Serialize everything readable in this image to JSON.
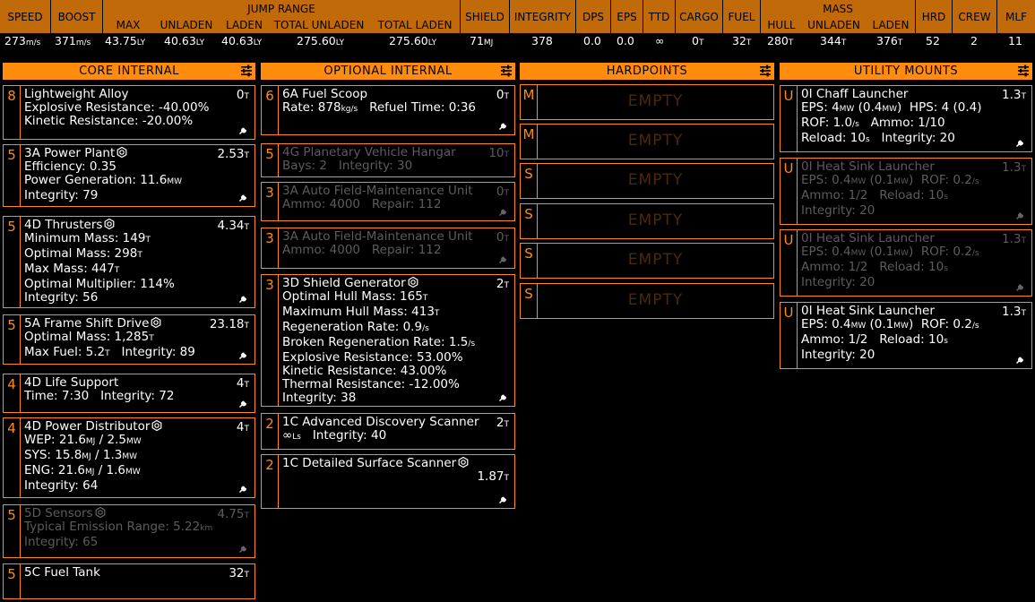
{
  "stats": {
    "headers": {
      "speed": "SPEED",
      "boost": "BOOST",
      "jump_range": "JUMP RANGE",
      "jr_max": "MAX",
      "jr_unladen": "UNLADEN",
      "jr_laden": "LADEN",
      "jr_total_unladen": "TOTAL UNLADEN",
      "jr_total_laden": "TOTAL LADEN",
      "shield": "SHIELD",
      "integrity": "INTEGRITY",
      "dps": "DPS",
      "eps": "EPS",
      "ttd": "TTD",
      "cargo": "CARGO",
      "fuel": "FUEL",
      "mass": "MASS",
      "mass_hull": "HULL",
      "mass_unladen": "UNLADEN",
      "mass_laden": "LADEN",
      "hrd": "HRD",
      "crew": "CREW",
      "mlf": "MLF"
    },
    "values": {
      "speed": "273",
      "speed_u": "m/s",
      "boost": "371",
      "boost_u": "m/s",
      "jr_max": "43.75",
      "jr_max_u": "LY",
      "jr_unladen": "40.63",
      "jr_unladen_u": "LY",
      "jr_laden": "40.63",
      "jr_laden_u": "LY",
      "jr_total_unladen": "275.60",
      "jr_total_unladen_u": "LY",
      "jr_total_laden": "275.60",
      "jr_total_laden_u": "LY",
      "shield": "71",
      "shield_u": "MJ",
      "integrity": "378",
      "dps": "0.0",
      "eps": "0.0",
      "ttd": "∞",
      "cargo": "0",
      "cargo_u": "T",
      "fuel": "32",
      "fuel_u": "T",
      "mass_hull": "280",
      "mass_hull_u": "T",
      "mass_unladen": "344",
      "mass_unladen_u": "T",
      "mass_laden": "376",
      "mass_laden_u": "T",
      "hrd": "52",
      "crew": "2",
      "mlf": "11"
    }
  },
  "columns": {
    "core": {
      "title": "CORE INTERNAL"
    },
    "optional": {
      "title": "OPTIONAL INTERNAL"
    },
    "hardpoints": {
      "title": "HARDPOINTS"
    },
    "utility": {
      "title": "UTILITY MOUNTS"
    }
  },
  "core": [
    {
      "cls": "8",
      "name": "Lightweight Alloy",
      "mass": "0",
      "mass_u": "T",
      "l1": "Explosive Resistance: -40.00%",
      "l2": "Kinetic Resistance: -20.00%"
    },
    {
      "cls": "5",
      "name": "3A Power Plant",
      "mass": "2.53",
      "mass_u": "T",
      "l1": "Efficiency: 0.35",
      "l2a": "Power Generation: 11.6",
      "l2u": "MW",
      "l3": "Integrity: 79"
    },
    {
      "cls": "5",
      "name": "4D Thrusters",
      "mass": "4.34",
      "mass_u": "T",
      "l1a": "Minimum Mass: 149",
      "l1u": "T",
      "l2a": "Optimal Mass: 298",
      "l2u": "T",
      "l3a": "Max Mass: 447",
      "l3u": "T",
      "l4": "Optimal Multiplier: 114%",
      "l5": "Integrity: 56"
    },
    {
      "cls": "5",
      "name": "5A Frame Shift Drive",
      "mass": "23.18",
      "mass_u": "T",
      "l1a": "Optimal Mass: 1,285",
      "l1u": "T",
      "l2a": "Max Fuel: 5.2",
      "l2u": "T",
      "l2b": "Integrity: 89"
    },
    {
      "cls": "4",
      "name": "4D Life Support",
      "mass": "4",
      "mass_u": "T",
      "l1": "Time: 7:30",
      "l1b": "Integrity: 72"
    },
    {
      "cls": "4",
      "name": "4D Power Distributor",
      "mass": "4",
      "mass_u": "T",
      "l1a": "WEP: 21.6",
      "l1u1": "MJ",
      "l1b": " / 2.5",
      "l1u2": "MW",
      "l2a": "SYS: 15.8",
      "l2u1": "MJ",
      "l2b": " / 1.3",
      "l2u2": "MW",
      "l3a": "ENG: 21.6",
      "l3u1": "MJ",
      "l3b": " / 1.6",
      "l3u2": "MW",
      "l4": "Integrity: 64"
    },
    {
      "cls": "5",
      "name": "5D Sensors",
      "mass": "4.75",
      "mass_u": "T",
      "l1a": "Typical Emission Range: 5.22",
      "l1u": "km",
      "l2": "Integrity: 65"
    },
    {
      "cls": "5",
      "name": "5C Fuel Tank",
      "mass": "32",
      "mass_u": "T"
    }
  ],
  "optional": [
    {
      "cls": "6",
      "name": "6A Fuel Scoop",
      "mass": "0",
      "mass_u": "T",
      "l1a": "Rate: 878",
      "l1u": "kg/s",
      "l1b": "Refuel Time: 0:36"
    },
    {
      "cls": "5",
      "name": "4G Planetary Vehicle Hangar",
      "mass": "10",
      "mass_u": "T",
      "l1": "Bays: 2",
      "l1b": "Integrity: 30"
    },
    {
      "cls": "3",
      "name": "3A Auto Field-Maintenance Unit",
      "mass": "0",
      "mass_u": "T",
      "l1": "Ammo: 4000",
      "l1b": "Repair: 112"
    },
    {
      "cls": "3",
      "name": "3A Auto Field-Maintenance Unit",
      "mass": "0",
      "mass_u": "T",
      "l1": "Ammo: 4000",
      "l1b": "Repair: 112"
    },
    {
      "cls": "3",
      "name": "3D Shield Generator",
      "mass": "2",
      "mass_u": "T",
      "l1a": "Optimal Hull Mass: 165",
      "l1u": "T",
      "l2a": "Maximum Hull Mass: 413",
      "l2u": "T",
      "l3a": "Regeneration Rate: 0.9",
      "l3u": "/s",
      "l4a": "Broken Regeneration Rate: 1.5",
      "l4u": "/s",
      "l5": "Explosive Resistance: 53.00%",
      "l6": "Kinetic Resistance: 43.00%",
      "l7": "Thermal Resistance: -12.00%",
      "l8": "Integrity: 38"
    },
    {
      "cls": "2",
      "name": "1C Advanced Discovery Scanner",
      "mass": "2",
      "mass_u": "T",
      "l1a": "∞",
      "l1u": "Ls",
      "l1b": "Integrity: 40"
    },
    {
      "cls": "2",
      "name": "1C Detailed Surface Scanner",
      "mass": "1.87",
      "mass_u": "T"
    }
  ],
  "hardpoints": [
    {
      "cls": "M",
      "label": "EMPTY"
    },
    {
      "cls": "M",
      "label": "EMPTY"
    },
    {
      "cls": "S",
      "label": "EMPTY"
    },
    {
      "cls": "S",
      "label": "EMPTY"
    },
    {
      "cls": "S",
      "label": "EMPTY"
    },
    {
      "cls": "S",
      "label": "EMPTY"
    }
  ],
  "utility": [
    {
      "cls": "U",
      "name": "0I Chaff Launcher",
      "mass": "1.3",
      "mass_u": "T",
      "l1a": "EPS: 4",
      "l1u": "MW",
      "l1b": " (0.4",
      "l1u2": "MW",
      "l1c": ")",
      "l1d": "HPS: 4 (0.4)",
      "l2a": "ROF: 1.0",
      "l2u": "/s",
      "l2b": "Ammo: 1/10",
      "l3a": "Reload: 10",
      "l3u": "s",
      "l3b": "Integrity: 20"
    },
    {
      "cls": "U",
      "name": "0I Heat Sink Launcher",
      "mass": "1.3",
      "mass_u": "T",
      "l1a": "EPS: 0.4",
      "l1u": "MW",
      "l1b": " (0.1",
      "l1u2": "MW",
      "l1c": ")",
      "l1d": "ROF: 0.2",
      "l1du": "/s",
      "l2a": "Ammo: 1/2",
      "l2b": "Reload: 10",
      "l2bu": "s",
      "l3": "Integrity: 20"
    },
    {
      "cls": "U",
      "name": "0I Heat Sink Launcher",
      "mass": "1.3",
      "mass_u": "T",
      "l1a": "EPS: 0.4",
      "l1u": "MW",
      "l1b": " (0.1",
      "l1u2": "MW",
      "l1c": ")",
      "l1d": "ROF: 0.2",
      "l1du": "/s",
      "l2a": "Ammo: 1/2",
      "l2b": "Reload: 10",
      "l2bu": "s",
      "l3": "Integrity: 20"
    },
    {
      "cls": "U",
      "name": "0I Heat Sink Launcher",
      "mass": "1.3",
      "mass_u": "T",
      "l1a": "EPS: 0.4",
      "l1u": "MW",
      "l1b": " (0.1",
      "l1u2": "MW",
      "l1c": ")",
      "l1d": "ROF: 0.2",
      "l1du": "/s",
      "l2a": "Ammo: 1/2",
      "l2b": "Reload: 10",
      "l2bu": "s",
      "l3": "Integrity: 20"
    }
  ]
}
